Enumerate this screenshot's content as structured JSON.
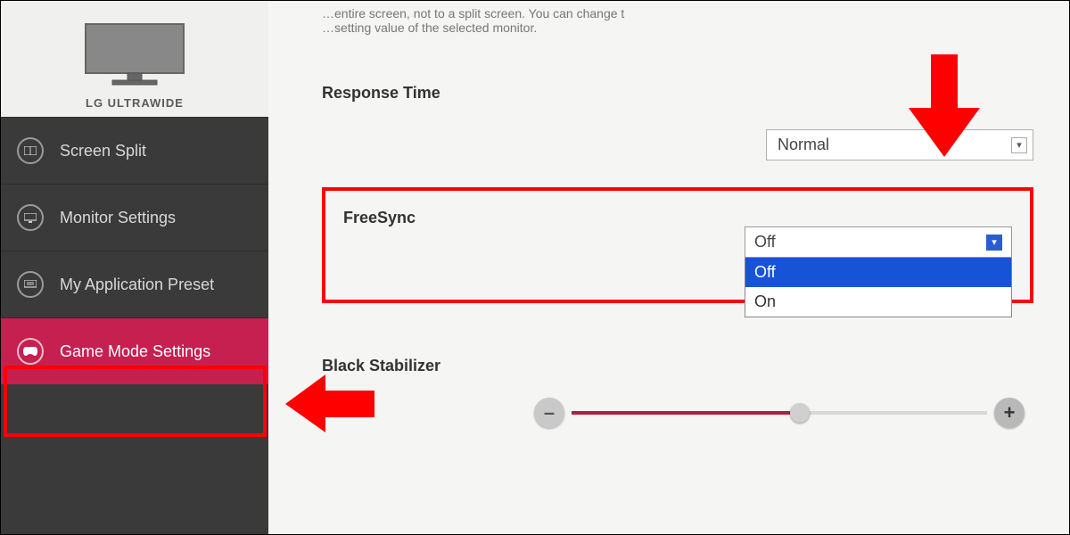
{
  "monitor": {
    "label": "LG ULTRAWIDE"
  },
  "sidebar": {
    "items": [
      {
        "label": "Screen Split"
      },
      {
        "label": "Monitor Settings"
      },
      {
        "label": "My Application Preset"
      },
      {
        "label": "Game Mode Settings"
      }
    ]
  },
  "description": {
    "line1": "…entire screen, not to a split screen. You can change t",
    "line2": "…setting value of the selected monitor."
  },
  "settings": {
    "responseTime": {
      "label": "Response Time",
      "value": "Normal"
    },
    "freeSync": {
      "label": "FreeSync",
      "value": "Off",
      "options": {
        "off": "Off",
        "on": "On"
      }
    },
    "blackStabilizer": {
      "label": "Black Stabilizer"
    }
  }
}
